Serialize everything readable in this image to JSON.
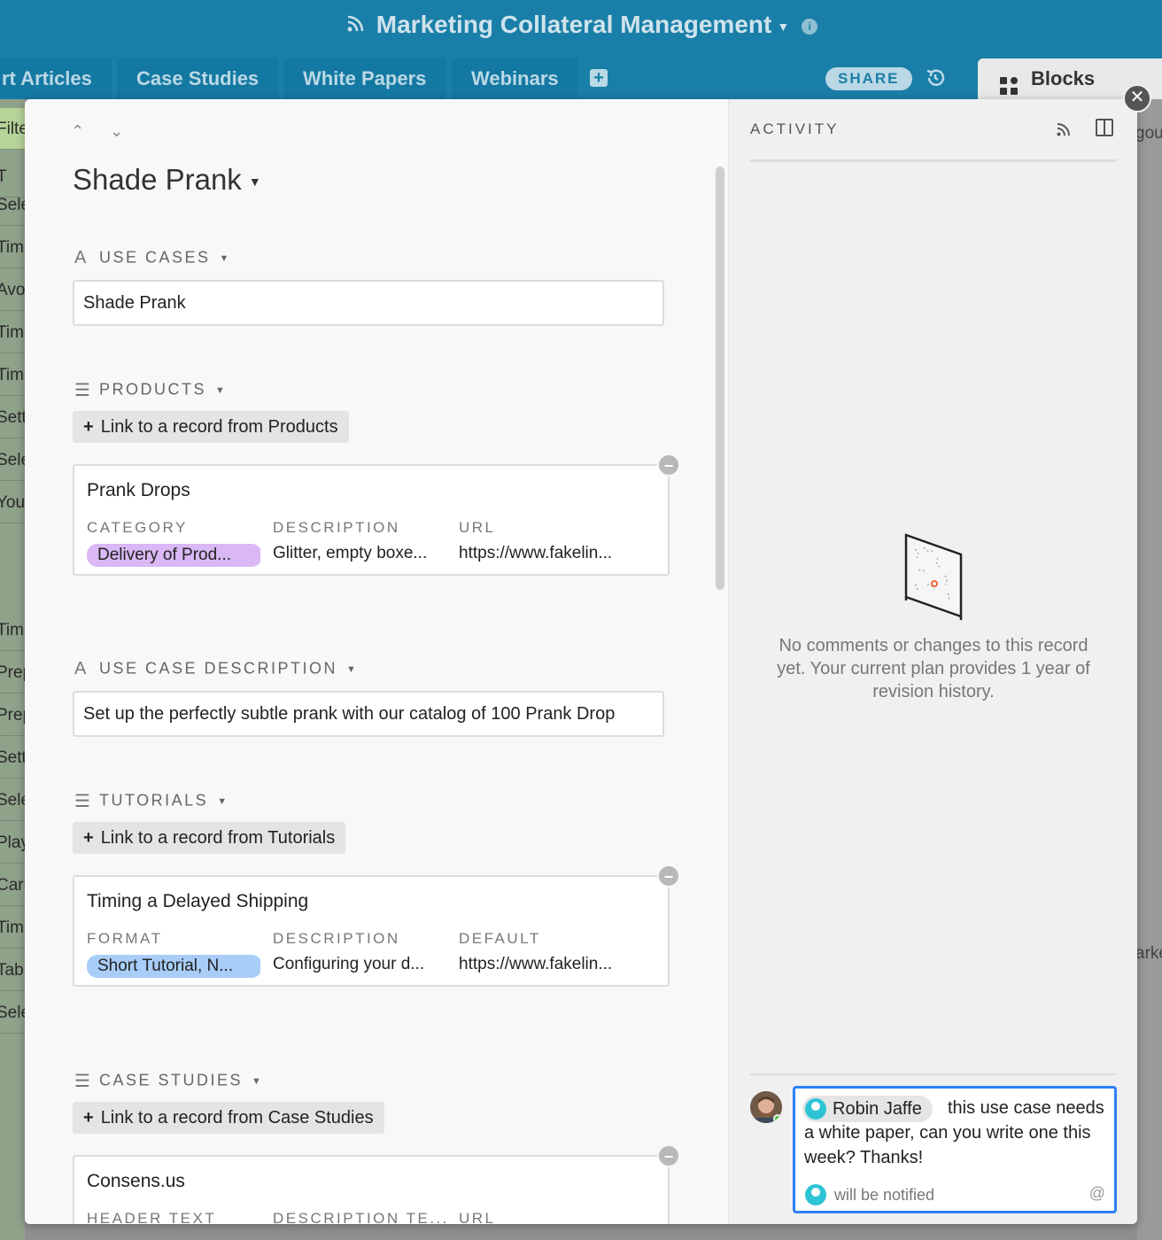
{
  "header": {
    "title": "Marketing Collateral Management",
    "info_icon": "i"
  },
  "tabs": [
    {
      "label": "rt Articles"
    },
    {
      "label": "Case Studies"
    },
    {
      "label": "White Papers"
    },
    {
      "label": "Webinars"
    }
  ],
  "toolbar": {
    "add_tab": "+",
    "share_label": "SHARE",
    "blocks_label": "Blocks"
  },
  "background_rows": [
    "Filte",
    "T",
    "Sele",
    "Tim",
    "Avo",
    "Tim",
    "Tim",
    "Sett",
    "Sele",
    "You",
    "",
    "",
    "Tim",
    "Prep",
    "Prep",
    "Sett",
    "Sele",
    "Play",
    "Cari",
    "Tim",
    "Tab",
    "Sele"
  ],
  "background_right": [
    "gou",
    "arke"
  ],
  "record": {
    "nav": "⌃ ⌄",
    "title": "Shade Prank",
    "fields": {
      "use_cases": {
        "label": "USE CASES",
        "value": "Shade Prank"
      },
      "products": {
        "label": "PRODUCTS",
        "link_label": "Link to a record from Products",
        "card": {
          "title": "Prank Drops",
          "columns": [
            {
              "header": "CATEGORY",
              "value": "Delivery of Prod..."
            },
            {
              "header": "DESCRIPTION",
              "value": "Glitter, empty boxe..."
            },
            {
              "header": "URL",
              "value": "https://www.fakelin..."
            }
          ]
        }
      },
      "use_case_description": {
        "label": "USE CASE DESCRIPTION",
        "value": "Set up the perfectly subtle prank with our catalog of 100 Prank Drop"
      },
      "tutorials": {
        "label": "TUTORIALS",
        "link_label": "Link to a record from Tutorials",
        "card": {
          "title": "Timing a Delayed Shipping",
          "columns": [
            {
              "header": "FORMAT",
              "value": "Short Tutorial, N..."
            },
            {
              "header": "DESCRIPTION",
              "value": "Configuring your d..."
            },
            {
              "header": "DEFAULT",
              "value": "https://www.fakelin..."
            }
          ]
        }
      },
      "case_studies": {
        "label": "CASE STUDIES",
        "link_label": "Link to a record from Case Studies",
        "card": {
          "title": "Consens.us",
          "columns": [
            {
              "header": "HEADER TEXT"
            },
            {
              "header": "DESCRIPTION TE..."
            },
            {
              "header": "URL"
            }
          ]
        }
      }
    }
  },
  "activity": {
    "title": "ACTIVITY",
    "empty_message": "No comments or changes to this record yet. Your current plan provides 1 year of revision history.",
    "comment": {
      "mention": "Robin Jaffe",
      "text": "this use case needs a white paper, can you write one this week? Thanks!",
      "notify": "will be notified",
      "at": "@"
    }
  },
  "colors": {
    "header_bg": "#1a7fa8",
    "pill_purple": "#d9b8f5",
    "pill_blue": "#a8cdf7",
    "comment_border": "#2d7ff9"
  }
}
